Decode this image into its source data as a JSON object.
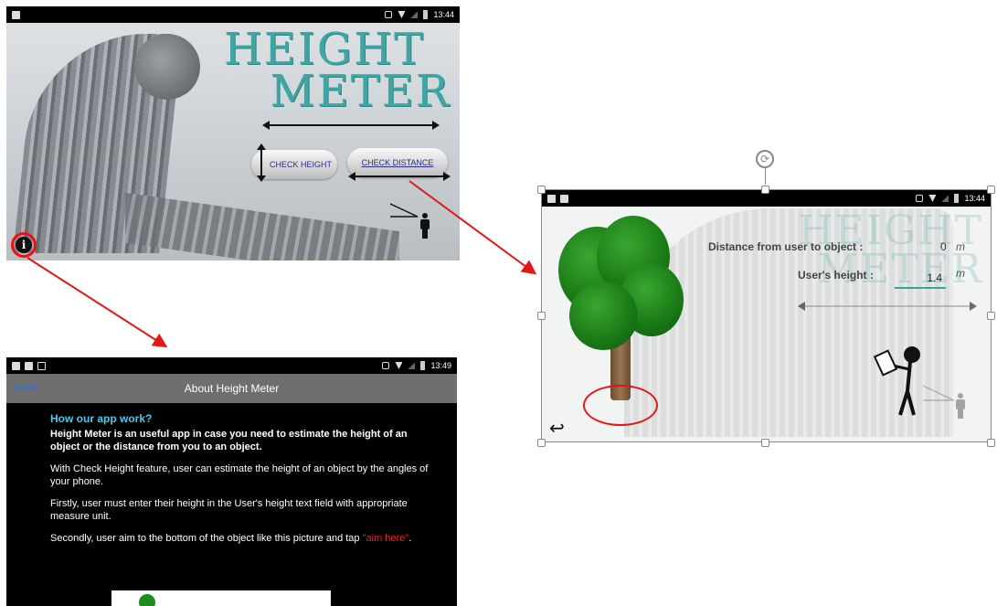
{
  "main_screen": {
    "status_time": "13:44",
    "title_line1": "HEIGHT",
    "title_line2": "METER",
    "check_height_label": "CHECK HEIGHT",
    "check_distance_label": "CHECK DISTANCE",
    "info_icon": "info-icon"
  },
  "measure_screen": {
    "status_time": "13:44",
    "faded_title_line1": "HEIGHT",
    "faded_title_line2": "METER",
    "distance_label": "Distance from user to object :",
    "distance_value": "0",
    "distance_unit": "m",
    "user_height_label": "User's height :",
    "user_height_value": "1.4",
    "user_height_unit": "m",
    "back_icon": "back-arrow-icon"
  },
  "about_screen": {
    "status_time": "13:49",
    "nav_title": "About Height Meter",
    "done_label": "Done",
    "heading": "How our app work?",
    "intro": "Height Meter is an useful app in case you need to estimate the height of an object or the distance from you to an object.",
    "para1": "With Check Height feature, user can estimate the height of an object by the angles of your phone.",
    "para2": "Firstly, user must enter their height in the User's height text field with appropriate measure unit.",
    "para3_prefix": "Secondly, user aim to the bottom of the object like this picture and tap ",
    "para3_link": "\"aim here\"",
    "para3_suffix": "."
  },
  "colors": {
    "title_teal": "#3fa6a5",
    "annotation_red": "#e01818",
    "link_blue": "#2f6fd6",
    "heading_cyan": "#4ec9e6"
  }
}
